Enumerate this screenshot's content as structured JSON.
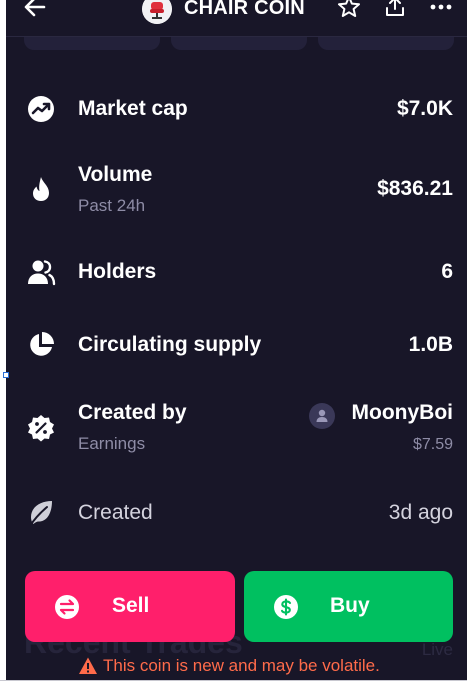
{
  "header": {
    "title": "CHAIR COIN",
    "back_icon": "arrow-left-icon",
    "star_icon": "star-icon",
    "share_icon": "share-icon",
    "more_icon": "more-horizontal-icon"
  },
  "stats": {
    "market_cap": {
      "label": "Market cap",
      "value": "$7.0K",
      "icon": "trending-up-icon"
    },
    "volume": {
      "label": "Volume",
      "sublabel": "Past 24h",
      "value": "$836.21",
      "icon": "flame-icon"
    },
    "holders": {
      "label": "Holders",
      "value": "6",
      "icon": "users-icon"
    },
    "circulating_supply": {
      "label": "Circulating supply",
      "value": "1.0B",
      "icon": "pie-chart-icon"
    },
    "created_by": {
      "label": "Created by",
      "sublabel": "Earnings",
      "creator": "MoonyBoi",
      "earnings": "$7.59",
      "icon": "percent-badge-icon"
    },
    "created": {
      "label": "Created",
      "value": "3d ago",
      "icon": "leaf-icon"
    }
  },
  "background": {
    "section_title": "Recent Trades",
    "live_label": "Live"
  },
  "actions": {
    "sell_label": "Sell",
    "buy_label": "Buy",
    "sell_color": "#ff1f6b",
    "buy_color": "#00c060"
  },
  "warning": {
    "text": "This coin is new and may be volatile.",
    "color": "#ff6b4a"
  },
  "theme": {
    "background": "#181628",
    "muted_text": "#8e8ca6"
  }
}
